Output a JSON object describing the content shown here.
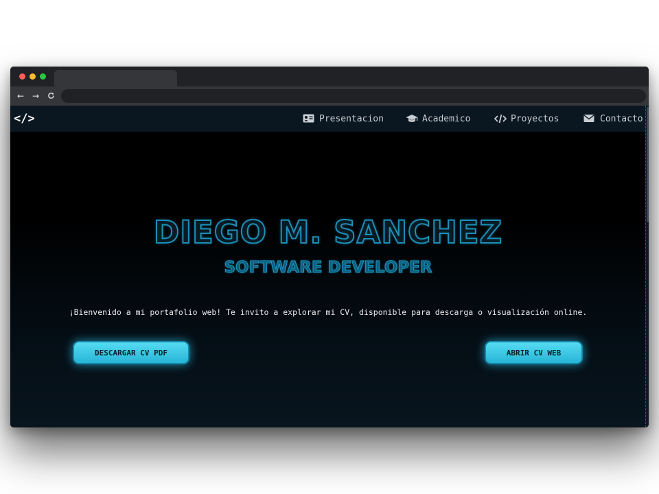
{
  "browser": {
    "tab_title": "",
    "url": "",
    "controls": {
      "close_color": "#ff5f57",
      "minimize_color": "#febc2e",
      "maximize_color": "#28c840"
    },
    "nav": {
      "back_icon": "arrow-left-icon",
      "back_glyph": "←",
      "forward_icon": "arrow-right-icon",
      "forward_glyph": "→",
      "reload_icon": "reload-icon",
      "reload_glyph": "C"
    }
  },
  "site": {
    "logo": "</>",
    "nav_items": [
      {
        "label": "Presentacion",
        "icon": "id-card-icon"
      },
      {
        "label": "Academico",
        "icon": "graduation-cap-icon"
      },
      {
        "label": "Proyectos",
        "icon": "code-icon"
      },
      {
        "label": "Contacto",
        "icon": "envelope-icon"
      }
    ],
    "colors": {
      "accent": "#1d8fb8",
      "button": "#3fcbe6",
      "background": "#000000"
    }
  },
  "hero": {
    "name": "DIEGO M. SANCHEZ",
    "role": "SOFTWARE DEVELOPER",
    "intro": "¡Bienvenido a mi portafolio web! Te invito a explorar mi CV, disponible para descarga o visualización online.",
    "buttons": {
      "download": "DESCARGAR CV PDF",
      "open": "ABRIR CV WEB"
    }
  }
}
